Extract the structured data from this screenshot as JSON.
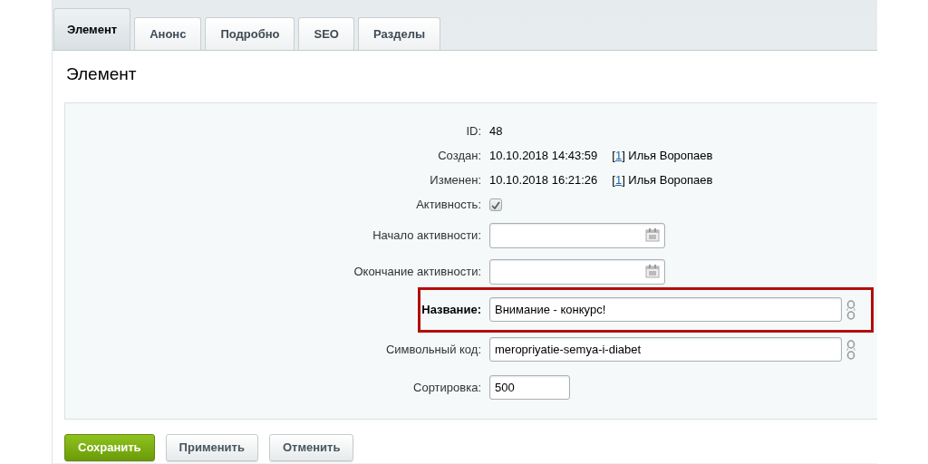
{
  "tabs": [
    {
      "label": "Элемент",
      "selected": true
    },
    {
      "label": "Анонс",
      "selected": false
    },
    {
      "label": "Подробно",
      "selected": false
    },
    {
      "label": "SEO",
      "selected": false
    },
    {
      "label": "Разделы",
      "selected": false
    }
  ],
  "section_title": "Элемент",
  "fields": [
    {
      "kind": "text",
      "label": "ID:",
      "value": "48"
    },
    {
      "kind": "meta",
      "label": "Создан:",
      "value": "10.10.2018 14:43:59",
      "author": {
        "open": "[",
        "link": "1",
        "close": "] Илья Воропаев"
      }
    },
    {
      "kind": "meta",
      "label": "Изменен:",
      "value": "10.10.2018 16:21:26",
      "author": {
        "open": "[",
        "link": "1",
        "close": "] Илья Воропаев"
      }
    },
    {
      "kind": "checkbox",
      "label": "Активность:",
      "checked": true
    },
    {
      "kind": "date",
      "label": "Начало активности:"
    },
    {
      "kind": "date",
      "label": "Окончание активности:"
    },
    {
      "kind": "input",
      "label": "Название:",
      "value": "Внимание - конкурс!",
      "required": true,
      "highlighted": true,
      "link_icon": true
    },
    {
      "kind": "input",
      "label": "Символьный код:",
      "value": "meropriyatie-semya-i-diabet",
      "required": false,
      "highlighted": false,
      "link_icon": true
    },
    {
      "kind": "short",
      "label": "Сортировка:",
      "value": "500"
    }
  ],
  "buttons": [
    {
      "label": "Сохранить",
      "primary": true
    },
    {
      "label": "Применить",
      "primary": false
    },
    {
      "label": "Отменить",
      "primary": false
    }
  ]
}
